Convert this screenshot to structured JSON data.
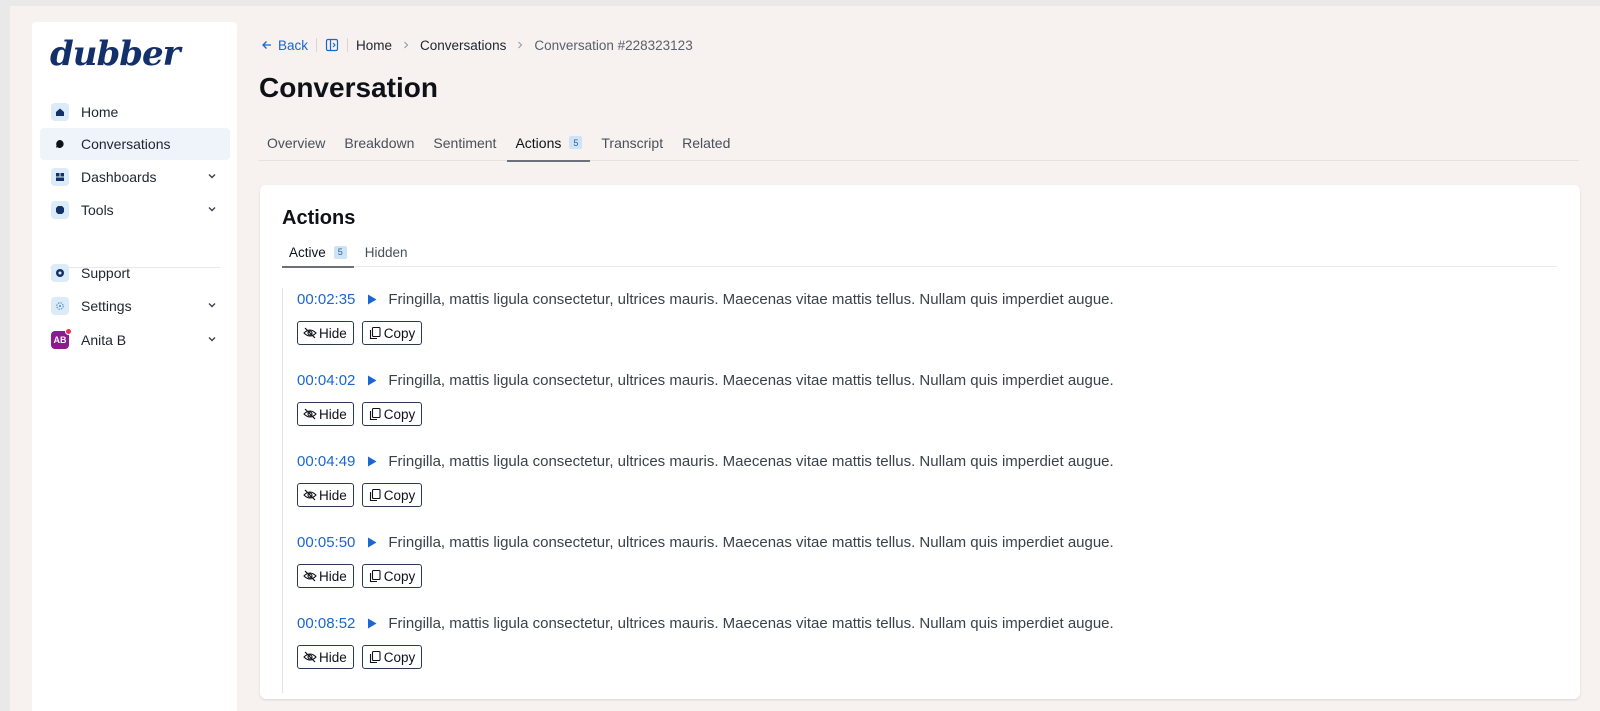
{
  "app": {
    "logo_text": "dubber"
  },
  "sidebar": {
    "items": [
      {
        "label": "Home",
        "icon": "home-icon",
        "active": false,
        "expandable": false
      },
      {
        "label": "Conversations",
        "icon": "chat-icon",
        "active": true,
        "expandable": false
      },
      {
        "label": "Dashboards",
        "icon": "dashboard-icon",
        "active": false,
        "expandable": true
      },
      {
        "label": "Tools",
        "icon": "tools-icon",
        "active": false,
        "expandable": true
      }
    ],
    "bottom_items": [
      {
        "label": "Support",
        "icon": "support-icon",
        "expandable": false
      },
      {
        "label": "Settings",
        "icon": "gear-icon",
        "expandable": true
      }
    ],
    "user": {
      "initials": "AB",
      "name": "Anita B",
      "notification_dot": true
    }
  },
  "breadcrumb": {
    "back_label": "Back",
    "items": [
      "Home",
      "Conversations"
    ],
    "current": "Conversation #228323123"
  },
  "page": {
    "title": "Conversation"
  },
  "tabs": [
    {
      "label": "Overview",
      "active": false
    },
    {
      "label": "Breakdown",
      "active": false
    },
    {
      "label": "Sentiment",
      "active": false
    },
    {
      "label": "Actions",
      "active": true,
      "badge": "5"
    },
    {
      "label": "Transcript",
      "active": false
    },
    {
      "label": "Related",
      "active": false
    }
  ],
  "card": {
    "title": "Actions",
    "subtabs": [
      {
        "label": "Active",
        "active": true,
        "badge": "5"
      },
      {
        "label": "Hidden",
        "active": false
      }
    ],
    "hide_label": "Hide",
    "copy_label": "Copy",
    "actions": [
      {
        "timestamp": "00:02:35",
        "text": "Fringilla, mattis ligula consectetur, ultrices mauris. Maecenas vitae mattis tellus. Nullam quis imperdiet augue."
      },
      {
        "timestamp": "00:04:02",
        "text": "Fringilla, mattis ligula consectetur, ultrices mauris. Maecenas vitae mattis tellus. Nullam quis imperdiet augue."
      },
      {
        "timestamp": "00:04:49",
        "text": "Fringilla, mattis ligula consectetur, ultrices mauris. Maecenas vitae mattis tellus. Nullam quis imperdiet augue."
      },
      {
        "timestamp": "00:05:50",
        "text": "Fringilla, mattis ligula consectetur, ultrices mauris. Maecenas vitae mattis tellus. Nullam quis imperdiet augue."
      },
      {
        "timestamp": "00:08:52",
        "text": "Fringilla, mattis ligula consectetur, ultrices mauris. Maecenas vitae mattis tellus. Nullam quis imperdiet augue."
      }
    ]
  },
  "colors": {
    "accent": "#1a66d2",
    "brand": "#14306b",
    "background": "#f7f2ef",
    "badge_bg": "#cfe3f6",
    "avatar_bg": "#8b1b8f"
  }
}
